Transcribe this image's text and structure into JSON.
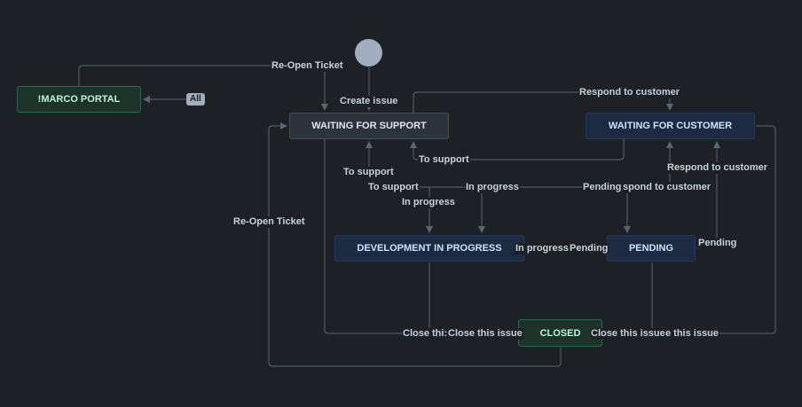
{
  "statuses": {
    "marco_portal": "!MARCO PORTAL",
    "waiting_for_support": "WAITING FOR SUPPORT",
    "waiting_for_customer": "WAITING FOR CUSTOMER",
    "development_in_progress": "DEVELOPMENT IN PROGRESS",
    "pending": "PENDING",
    "closed": "CLOSED"
  },
  "all_badge": "All",
  "transitions": {
    "reopen_top": "Re-Open Ticket",
    "create_issue": "Create issue",
    "respond_to_customer_top": "Respond to customer",
    "to_support_right": "To support",
    "respond_to_customer_right": "Respond to customer",
    "to_support_left": "To support",
    "to_support_mid": "To support",
    "in_progress_top": "In progress",
    "pending_mid": "Pending",
    "spond_to_customer": "spond to customer",
    "in_progress_left": "In progress",
    "reopen_left": "Re-Open Ticket",
    "in_progress_right": "In progress",
    "pending_left": "Pending",
    "pending_right": "Pending",
    "close_partial": "Close thi:",
    "close_1": "Close this issue",
    "close_2": "Close this issue",
    "close_3": "e this issue"
  },
  "colors": {
    "background": "#1d2125",
    "line": "#5b6570",
    "blue_node": "#1c2b41",
    "green_node": "#1c3329",
    "grey_node": "#2c333a",
    "start_circle": "#a1aec0"
  }
}
